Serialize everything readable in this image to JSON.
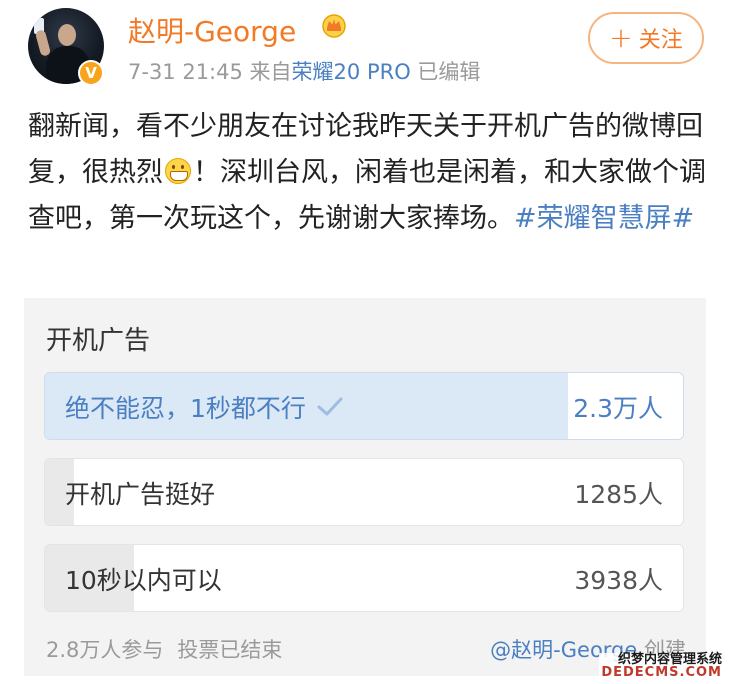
{
  "header": {
    "username": "赵明-George",
    "timestamp": "7-31 21:45",
    "source_prefix": "来自",
    "source_device": "荣耀20 PRO",
    "edited": "已编辑",
    "follow_label": "关注",
    "verified_badge": "V",
    "icons": [
      "avatar",
      "verified-badge-icon",
      "crown-icon",
      "plus-icon"
    ]
  },
  "post": {
    "text_part1": "翻新闻，看不少朋友在讨论我昨天关于开机广告的微博回复，很热烈",
    "text_part2": "！深圳台风，闲着也是闲着，和大家做个调查吧，第一次玩这个，先谢谢大家捧场。",
    "topic": "#荣耀智慧屏#",
    "emoji": "grinning-emoji"
  },
  "poll": {
    "title": "开机广告",
    "options": [
      {
        "label": "绝不能忍，1秒都不行",
        "count": "2.3万人",
        "fraction": 0.82,
        "voted": true
      },
      {
        "label": "开机广告挺好",
        "count": "1285人",
        "fraction": 0.046
      },
      {
        "label": "10秒以内可以",
        "count": "3938人",
        "fraction": 0.14
      }
    ],
    "participants": "2.8万人参与",
    "status": "投票已结束",
    "creator": "@赵明-George",
    "creator_suffix": "创建"
  },
  "watermark": {
    "line1": "织梦内容管理系统",
    "line2": "DEDECMS.COM"
  },
  "colors": {
    "username": "#f27a26",
    "link": "#4a7fc1",
    "meta": "#9a9a9a",
    "voted_fill": "#dbe8f6",
    "option_fill": "#e9e9e9",
    "poll_bg": "#f3f3f3"
  }
}
